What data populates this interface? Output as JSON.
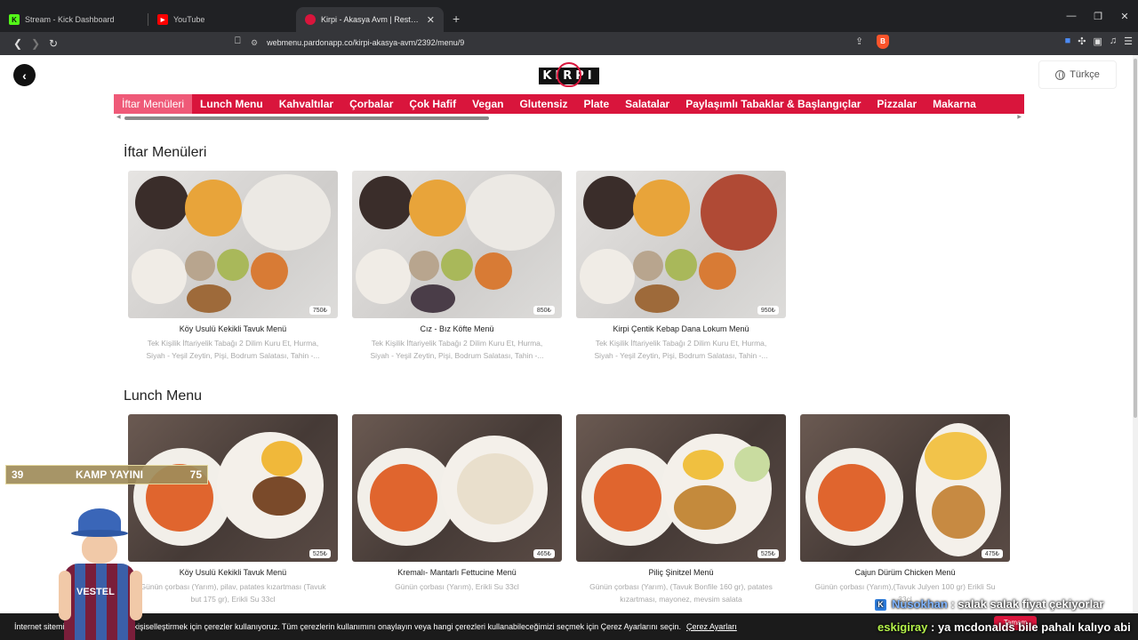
{
  "browser": {
    "tabs": [
      {
        "label": "Stream - Kick Dashboard",
        "icon": "kick-icon",
        "color": "#53fc18"
      },
      {
        "label": "YouTube",
        "icon": "youtube-icon",
        "color": "#ff0000"
      },
      {
        "label": "Kirpi - Akasya Avm | Restaurant ...",
        "icon": "kirpi-icon",
        "color": "#d9153c"
      }
    ],
    "url": "webmenu.pardonapp.co/kirpi-akasya-avm/2392/menu/9"
  },
  "header": {
    "logo_text": "KIRPI",
    "language": "Türkçe"
  },
  "categories": [
    "İftar Menüleri",
    "Lunch Menu",
    "Kahvaltılar",
    "Çorbalar",
    "Çok Hafif",
    "Vegan",
    "Glutensiz",
    "Plate",
    "Salatalar",
    "Paylaşımlı Tabaklar & Başlangıçlar",
    "Pizzalar",
    "Makarna"
  ],
  "sections": [
    {
      "title": "İftar Menüleri",
      "items": [
        {
          "name": "Köy Usulü Kekikli Tavuk Menü",
          "price": "750₺",
          "desc": "Tek Kişilik İftariyelik Tabağı 2 Dilim Kuru Et, Hurma, Siyah - Yeşil Zeytin, Pişi, Bodrum Salatası, Tahin -..."
        },
        {
          "name": "Cız - Bız Köfte Menü",
          "price": "850₺",
          "desc": "Tek Kişilik İftariyelik Tabağı 2 Dilim Kuru Et, Hurma, Siyah - Yeşil Zeytin, Pişi, Bodrum Salatası, Tahin -..."
        },
        {
          "name": "Kirpi Çentik Kebap Dana Lokum Menü",
          "price": "950₺",
          "desc": "Tek Kişilik İftariyelik Tabağı 2 Dilim Kuru Et, Hurma, Siyah - Yeşil Zeytin, Pişi, Bodrum Salatası, Tahin -..."
        }
      ]
    },
    {
      "title": "Lunch Menu",
      "items": [
        {
          "name": "Köy Usulü Kekikli Tavuk Menü",
          "price": "525₺",
          "desc": "Günün çorbası (Yarım), pilav, patates kızartması (Tavuk but 175 gr), Erikli Su 33cl"
        },
        {
          "name": "Kremalı- Mantarlı Fettucine Menü",
          "price": "465₺",
          "desc": "Günün çorbası (Yarım), Erikli Su 33cl"
        },
        {
          "name": "Piliç Şinitzel Menü",
          "price": "525₺",
          "desc": "Günün çorbası (Yarım), (Tavuk Bonfile 160 gr), patates kızartması, mayonez, mevsim salata"
        },
        {
          "name": "Cajun Dürüm Chicken Menü",
          "price": "475₺",
          "desc": "Günün çorbası (Yarım),(Tavuk Julyen 100 gr) Erikli Su 33cl"
        }
      ]
    }
  ],
  "cookie": {
    "text": "İnternet sitemizi ... iyileştirmek ve kişiselleştirmek için çerezler kullanıyoruz. Tüm çerezlerin kullanımını onaylayın veya hangi çerezleri kullanabileceğimizi seçmek için Çerez Ayarlarını seçin.",
    "settings_link": "Çerez Ayarları",
    "accept": "Tamam"
  },
  "stream_overlay": {
    "left_num": "39",
    "title": "KAMP YAYINI",
    "right_num": "75",
    "shirt_text": "VESTEL"
  },
  "chat": [
    {
      "user": "Nusokhan",
      "message": ": salak salak fiyat çekiyorlar"
    },
    {
      "user": "eskigiray",
      "message": ": ya mcdonalds bile pahalı kalıyo abi"
    }
  ]
}
